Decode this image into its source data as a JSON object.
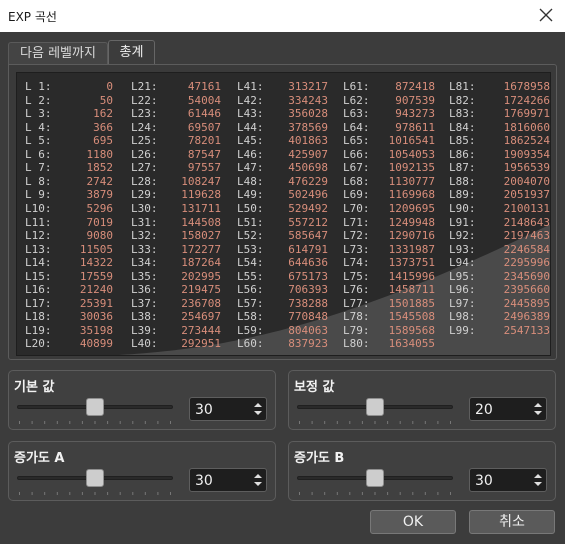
{
  "window": {
    "title": "EXP 곡선",
    "close_icon": "close-icon"
  },
  "tabs": [
    {
      "label": "다음 레벨까지",
      "active": false
    },
    {
      "label": "총계",
      "active": true
    }
  ],
  "table": {
    "columns": [
      {
        "labels": [
          "L 1:",
          "L 2:",
          "L 3:",
          "L 4:",
          "L 5:",
          "L 6:",
          "L 7:",
          "L 8:",
          "L 9:",
          "L10:",
          "L11:",
          "L12:",
          "L13:",
          "L14:",
          "L15:",
          "L16:",
          "L17:",
          "L18:",
          "L19:",
          "L20:"
        ],
        "values": [
          "0",
          "50",
          "162",
          "366",
          "695",
          "1180",
          "1852",
          "2742",
          "3879",
          "5296",
          "7019",
          "9080",
          "11505",
          "14322",
          "17559",
          "21240",
          "25391",
          "30036",
          "35198",
          "40899"
        ]
      },
      {
        "labels": [
          "L21:",
          "L22:",
          "L23:",
          "L24:",
          "L25:",
          "L26:",
          "L27:",
          "L28:",
          "L29:",
          "L30:",
          "L31:",
          "L32:",
          "L33:",
          "L34:",
          "L35:",
          "L36:",
          "L37:",
          "L38:",
          "L39:",
          "L40:"
        ],
        "values": [
          "47161",
          "54004",
          "61446",
          "69507",
          "78201",
          "87547",
          "97557",
          "108247",
          "119628",
          "131711",
          "144508",
          "158027",
          "172277",
          "187264",
          "202995",
          "219475",
          "236708",
          "254697",
          "273444",
          "292951"
        ]
      },
      {
        "labels": [
          "L41:",
          "L42:",
          "L43:",
          "L44:",
          "L45:",
          "L46:",
          "L47:",
          "L48:",
          "L49:",
          "L50:",
          "L51:",
          "L52:",
          "L53:",
          "L54:",
          "L55:",
          "L56:",
          "L57:",
          "L58:",
          "L59:",
          "L60:"
        ],
        "values": [
          "313217",
          "334243",
          "356028",
          "378569",
          "401863",
          "425907",
          "450698",
          "476229",
          "502496",
          "529492",
          "557212",
          "585647",
          "614791",
          "644636",
          "675173",
          "706393",
          "738288",
          "770848",
          "804063",
          "837923"
        ]
      },
      {
        "labels": [
          "L61:",
          "L62:",
          "L63:",
          "L64:",
          "L65:",
          "L66:",
          "L67:",
          "L68:",
          "L69:",
          "L70:",
          "L71:",
          "L72:",
          "L73:",
          "L74:",
          "L75:",
          "L76:",
          "L77:",
          "L78:",
          "L79:",
          "L80:"
        ],
        "values": [
          "872418",
          "907539",
          "943273",
          "978611",
          "1016541",
          "1054053",
          "1092135",
          "1130777",
          "1169968",
          "1209695",
          "1249948",
          "1290716",
          "1331987",
          "1373751",
          "1415996",
          "1458711",
          "1501885",
          "1545508",
          "1589568",
          "1634055"
        ]
      },
      {
        "labels": [
          "L81:",
          "L82:",
          "L83:",
          "L84:",
          "L85:",
          "L86:",
          "L87:",
          "L88:",
          "L89:",
          "L90:",
          "L91:",
          "L92:",
          "L93:",
          "L94:",
          "L95:",
          "L96:",
          "L97:",
          "L98:",
          "L99:"
        ],
        "values": [
          "1678958",
          "1724266",
          "1769971",
          "1816060",
          "1862524",
          "1909354",
          "1956539",
          "2004070",
          "2051937",
          "2100131",
          "2148643",
          "2197463",
          "2246584",
          "2295996",
          "2345690",
          "2395660",
          "2445895",
          "2496389",
          "2547133"
        ]
      }
    ]
  },
  "controls": {
    "base": {
      "title": "기본 값",
      "value": "30",
      "slider_fraction": 0.5
    },
    "correction": {
      "title": "보정 값",
      "value": "20",
      "slider_fraction": 0.5
    },
    "increase_a": {
      "title": "증가도 A",
      "value": "30",
      "slider_fraction": 0.5
    },
    "increase_b": {
      "title": "증가도 B",
      "value": "30",
      "slider_fraction": 0.5
    }
  },
  "buttons": {
    "ok": "OK",
    "cancel": "취소"
  },
  "colors": {
    "value_text": "#d98e7b",
    "label_text": "#d0d0d0",
    "curve_fill": "#4a4a4a",
    "table_bg": "#2a2a2a"
  }
}
